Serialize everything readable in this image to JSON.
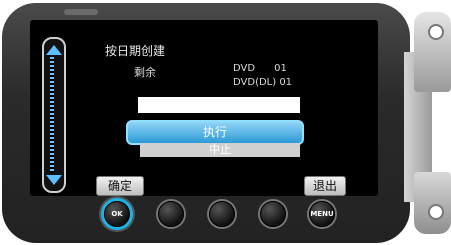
{
  "dialog": {
    "title": "按日期创建",
    "remaining_label": "剩余",
    "dvd_label": "DVD      01",
    "dvd_dl_label": "DVD(DL) 01",
    "progress_percent": 100
  },
  "buttons": {
    "execute": "执行",
    "stop": "中止"
  },
  "soft_keys": {
    "left": "确定",
    "right": "退出"
  },
  "hardware_buttons": [
    {
      "label": "OK",
      "icon": "ok-button-icon"
    },
    {
      "label": "",
      "icon": "circle-button-icon"
    },
    {
      "label": "",
      "icon": "circle-button-icon"
    },
    {
      "label": "",
      "icon": "circle-button-icon"
    },
    {
      "label": "MENU",
      "icon": "menu-button-icon"
    }
  ],
  "colors": {
    "accent": "#19b5e8",
    "highlight": "#2d9ad6",
    "screen": "#000000"
  }
}
